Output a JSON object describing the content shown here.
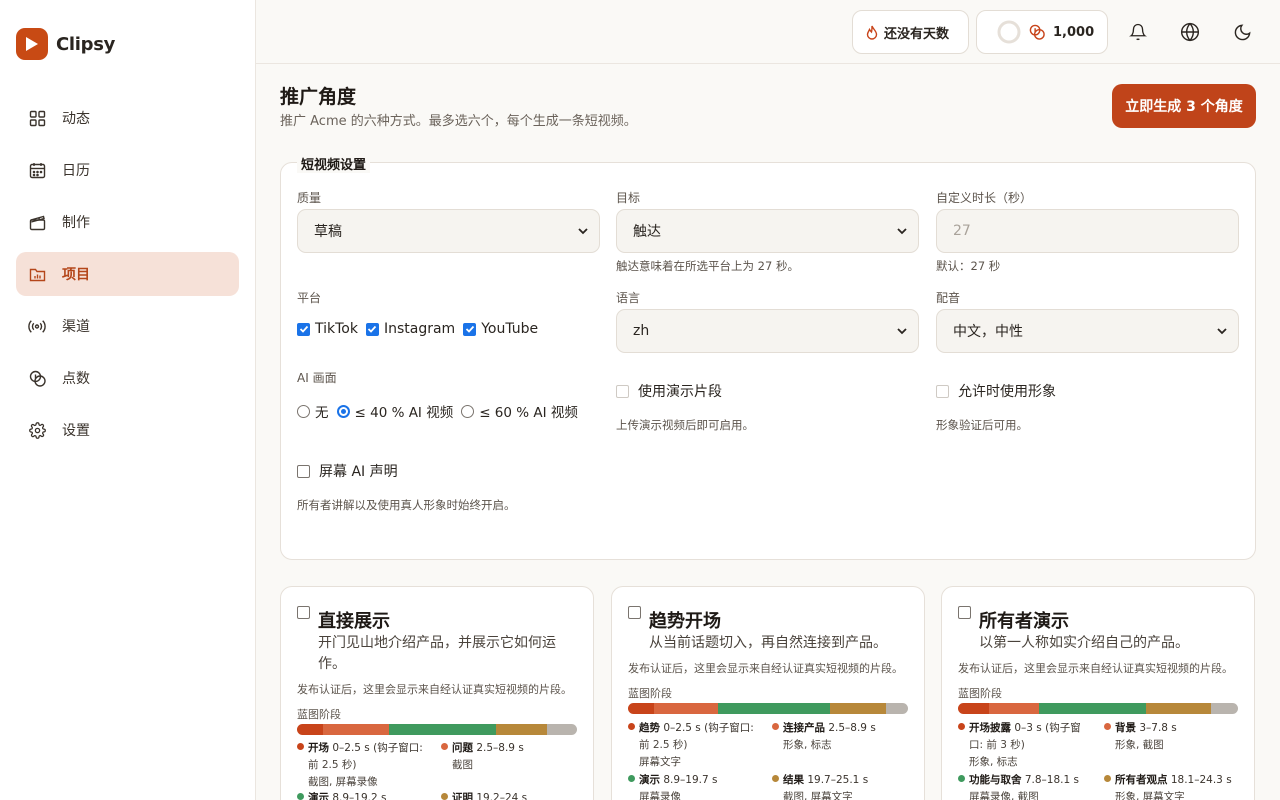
{
  "app": {
    "name": "Clipsy"
  },
  "colors": {
    "accent": "#c0441a",
    "active_bg": "#f6e1d8",
    "checkbox": "#1a73e8"
  },
  "sidebar": {
    "items": [
      {
        "label": "动态",
        "icon": "grid-icon"
      },
      {
        "label": "日历",
        "icon": "calendar-icon"
      },
      {
        "label": "制作",
        "icon": "clapperboard-icon"
      },
      {
        "label": "项目",
        "icon": "folder-chart-icon",
        "active": true
      },
      {
        "label": "渠道",
        "icon": "broadcast-icon"
      },
      {
        "label": "点数",
        "icon": "coins-icon"
      },
      {
        "label": "设置",
        "icon": "gear-icon"
      }
    ]
  },
  "topbar": {
    "streak_label": "还没有天数",
    "credits_value": "1,000"
  },
  "page": {
    "title": "推广角度",
    "subtitle": "推广 Acme 的六种方式。最多选六个，每个生成一条短视频。",
    "generate_button": "立即生成 3 个角度"
  },
  "settings": {
    "legend": "短视频设置",
    "quality": {
      "label": "质量",
      "value": "草稿"
    },
    "goal": {
      "label": "目标",
      "value": "触达",
      "hint": "触达意味着在所选平台上为 27 秒。"
    },
    "duration": {
      "label": "自定义时长（秒）",
      "placeholder": "27",
      "hint": "默认：27 秒"
    },
    "platform": {
      "label": "平台",
      "options": [
        "TikTok",
        "Instagram",
        "YouTube"
      ]
    },
    "language": {
      "label": "语言",
      "value": "zh"
    },
    "voice": {
      "label": "配音",
      "value": "中文，中性"
    },
    "ai_visuals": {
      "label": "AI 画面",
      "options": [
        "无",
        "≤ 40 % AI 视频",
        "≤ 60 % AI 视频"
      ],
      "selected": 1
    },
    "demo_clips": {
      "label": "使用演示片段",
      "hint": "上传演示视频后即可启用。"
    },
    "avatar": {
      "label": "允许时使用形象",
      "hint": "形象验证后可用。"
    },
    "ai_disclosure": {
      "label": "屏幕 AI 声明",
      "hint": "所有者讲解以及使用真人形象时始终开启。"
    }
  },
  "angles": [
    {
      "title": "直接展示",
      "desc_line1": "开门见山地介绍产品，并展示它如何运",
      "desc_line2": "作。",
      "note": "发布认证后，这里会显示来自经认证真实短视频的片段。",
      "blueprint_label": "蓝图阶段",
      "segments": [
        {
          "color": "#c8441a",
          "share": 0.093
        },
        {
          "color": "#d9673f",
          "share": 0.237
        },
        {
          "color": "#3f9a5e",
          "share": 0.38
        },
        {
          "color": "#b7883a",
          "share": 0.183
        },
        {
          "color": "#b9b4ae",
          "share": 0.107
        }
      ],
      "stages": [
        {
          "name": "开场",
          "time": "0–2.5 s (钩子窗口:",
          "time2": "前 2.5 秒)",
          "sub": "截图, 屏幕录像",
          "color": "#c8441a"
        },
        {
          "name": "问题",
          "time": "2.5–8.9 s",
          "sub": "截图",
          "color": "#d9673f"
        },
        {
          "name": "演示",
          "time": "8.9–19.2 s",
          "sub": "",
          "color": "#3f9a5e"
        },
        {
          "name": "证明",
          "time": "19.2–24 s",
          "sub": "",
          "color": "#b7883a"
        }
      ]
    },
    {
      "title": "趋势开场",
      "desc_line1": "从当前话题切入，再自然连接到产品。",
      "desc_line2": "",
      "note": "发布认证后，这里会显示来自经认证真实短视频的片段。",
      "blueprint_label": "蓝图阶段",
      "segments": [
        {
          "color": "#c8441a",
          "share": 0.093
        },
        {
          "color": "#d9673f",
          "share": 0.229
        },
        {
          "color": "#3f9a5e",
          "share": 0.4
        },
        {
          "color": "#b7883a",
          "share": 0.2
        },
        {
          "color": "#b9b4ae",
          "share": 0.078
        }
      ],
      "stages": [
        {
          "name": "趋势",
          "time": "0–2.5 s (钩子窗口:",
          "time2": "前 2.5 秒)",
          "sub": "屏幕文字",
          "color": "#c8441a"
        },
        {
          "name": "连接产品",
          "time": "2.5–8.9 s",
          "sub": "形象, 标志",
          "color": "#d9673f"
        },
        {
          "name": "演示",
          "time": "8.9–19.7 s",
          "sub": "屏幕录像",
          "color": "#3f9a5e"
        },
        {
          "name": "结果",
          "time": "19.7–25.1 s",
          "sub": "截图, 屏幕文字",
          "color": "#b7883a"
        }
      ]
    },
    {
      "title": "所有者演示",
      "desc_line1": "以第一人称如实介绍自己的产品。",
      "desc_line2": "",
      "note": "发布认证后，这里会显示来自经认证真实短视频的片段。",
      "blueprint_label": "蓝图阶段",
      "segments": [
        {
          "color": "#c8441a",
          "share": 0.111
        },
        {
          "color": "#d9673f",
          "share": 0.18
        },
        {
          "color": "#3f9a5e",
          "share": 0.379
        },
        {
          "color": "#b7883a",
          "share": 0.232
        },
        {
          "color": "#b9b4ae",
          "share": 0.098
        }
      ],
      "stages": [
        {
          "name": "开场披露",
          "time": "0–3 s (钩子窗",
          "time2": "口: 前 3 秒)",
          "sub": "形象, 标志",
          "color": "#c8441a"
        },
        {
          "name": "背景",
          "time": "3–7.8 s",
          "sub": "形象, 截图",
          "color": "#d9673f"
        },
        {
          "name": "功能与取舍",
          "time": "7.8–18.1 s",
          "sub": "屏幕录像, 截图",
          "color": "#3f9a5e"
        },
        {
          "name": "所有者观点",
          "time": "18.1–24.3 s",
          "sub": "形象, 屏幕文字",
          "color": "#b7883a"
        }
      ]
    }
  ]
}
